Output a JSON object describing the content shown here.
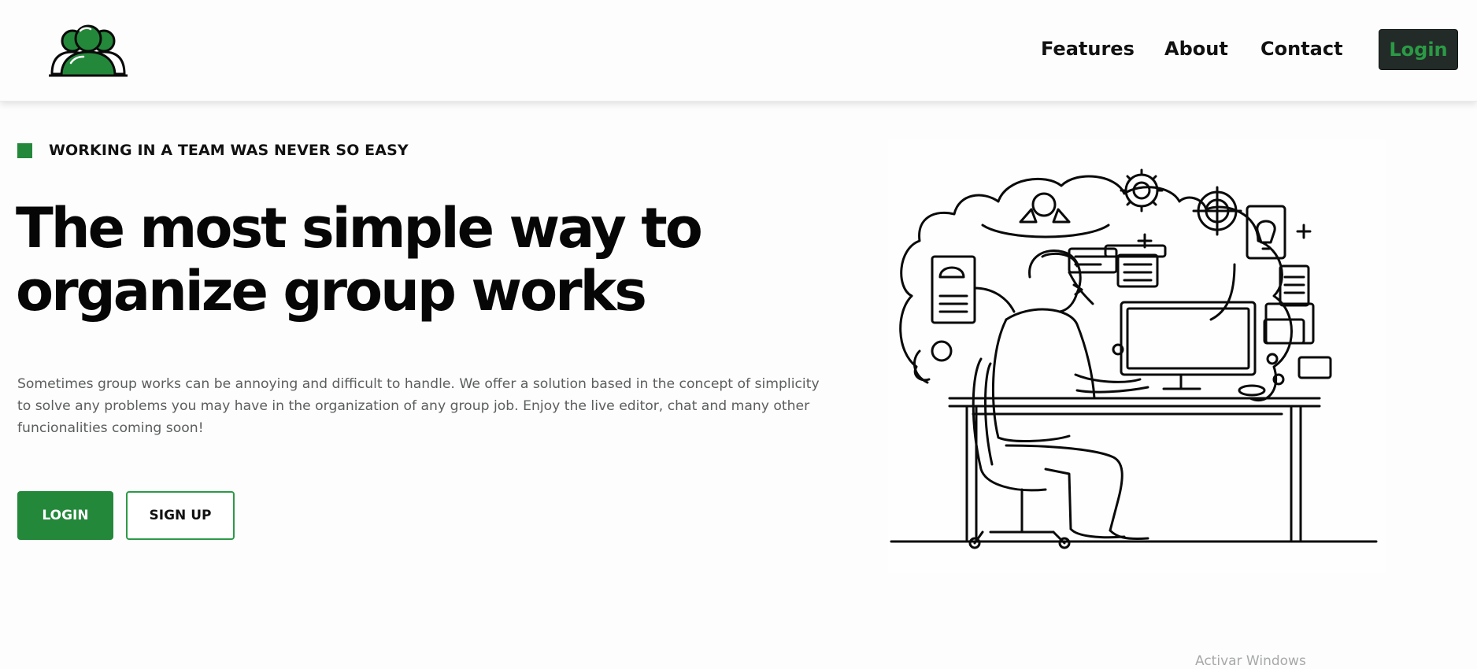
{
  "header": {
    "logo_icon": "team-people-icon",
    "nav": [
      {
        "label": "Features"
      },
      {
        "label": "About"
      },
      {
        "label": "Contact"
      }
    ],
    "login_label": "Login"
  },
  "hero": {
    "eyebrow": "WORKING IN A TEAM WAS NEVER SO EASY",
    "title_line1": "The most simple way to",
    "title_line2": "organize group works",
    "description": "Sometimes group works can be annoying and difficult to handle. We offer a solution based in the concept of simplicity to solve any problems you may have in the organization of any group job. Enjoy the live editor, chat and many other funcionalities coming soon!",
    "primary_button": "LOGIN",
    "secondary_button": "SIGN UP",
    "illustration_icon": "person-working-at-computer-illustration"
  },
  "system": {
    "watermark": "Activar Windows"
  },
  "colors": {
    "brand_green": "#24883b",
    "login_bg": "#232b28",
    "login_text": "#2b9a45",
    "background": "#fcfdfc"
  }
}
